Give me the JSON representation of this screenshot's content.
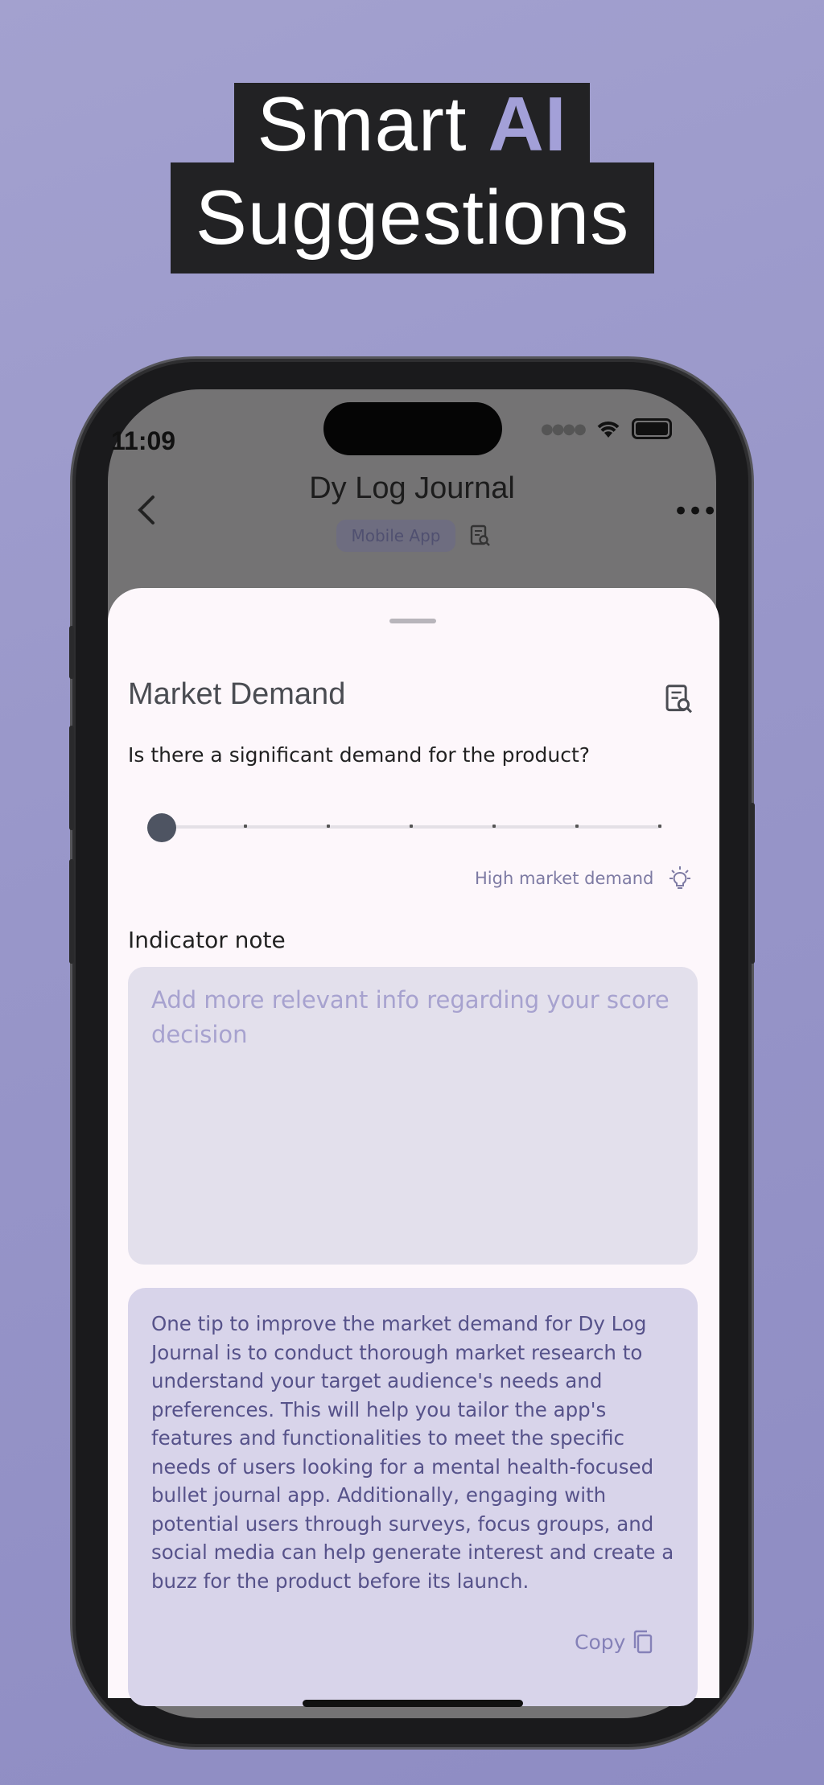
{
  "headline": {
    "line1": "Smart",
    "accent": "AI",
    "line2": "Suggestions"
  },
  "status_bar": {
    "time": "11:09"
  },
  "header": {
    "title": "Dy Log Journal",
    "category_chip": "Mobile App"
  },
  "sheet": {
    "title": "Market Demand",
    "question": "Is there a significant demand for the product?",
    "slider": {
      "value": 0,
      "min": 0,
      "max": 6,
      "steps": 7
    },
    "ai_hint": "High market demand",
    "note_label": "Indicator note",
    "note_placeholder": "Add more relevant info regarding your score decision",
    "ai_tip": "One tip to improve the market demand for Dy Log Journal is to conduct thorough market research to understand your target audience's needs and preferences. This will help you tailor the app's features and functionalities to meet the specific needs of users looking for a mental health-focused bullet journal app. Additionally, engaging with potential users through surveys, focus groups, and social media can help generate interest and create a buzz for the product before its launch.",
    "copy_label": "Copy"
  },
  "colors": {
    "background": "#9896c9",
    "accent": "#a3a0d8",
    "sheet": "#fdf7fb",
    "tip_box": "#d8d4ea",
    "tip_text": "#56528a"
  },
  "icons": [
    "back-arrow-icon",
    "more-icon",
    "report-search-icon",
    "lightbulb-icon",
    "copy-icon",
    "wifi-icon",
    "battery-icon"
  ]
}
